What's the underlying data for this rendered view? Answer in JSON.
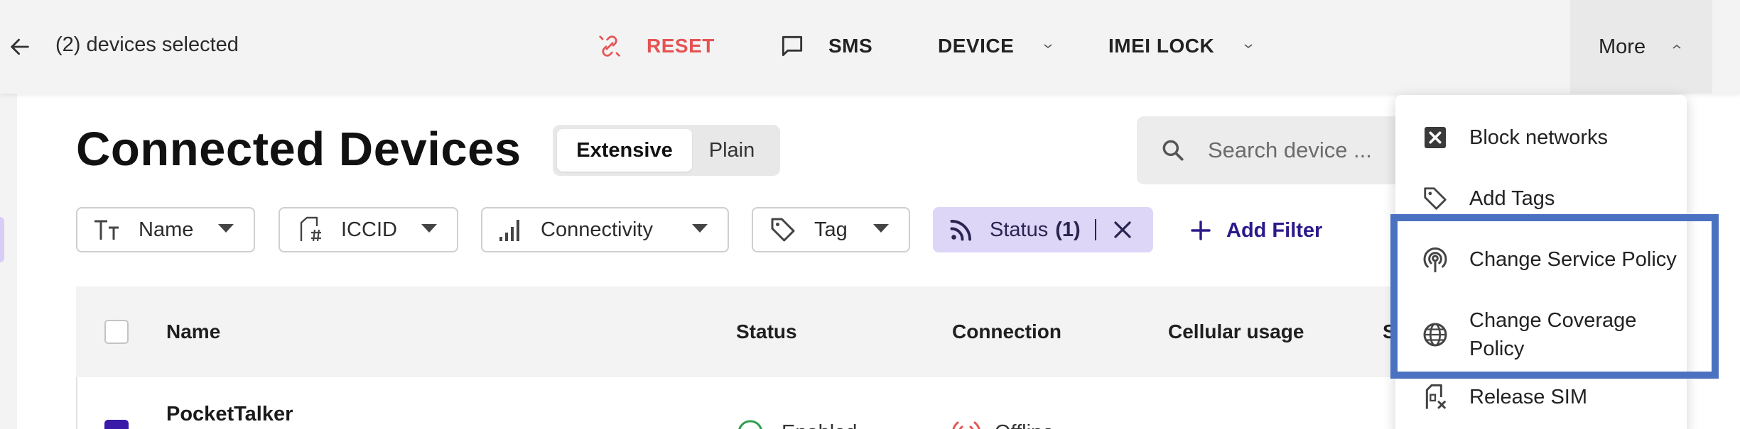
{
  "topbar": {
    "selected_text": "(2) devices selected",
    "actions": {
      "reset": "RESET",
      "sms": "SMS",
      "device": "DEVICE",
      "imei_lock": "IMEI LOCK"
    },
    "more": "More"
  },
  "header": {
    "title": "Connected Devices",
    "view_toggle": {
      "extensive": "Extensive",
      "plain": "Plain",
      "selected": "Extensive"
    },
    "search_placeholder": "Search device ..."
  },
  "filters": {
    "name": "Name",
    "iccid": "ICCID",
    "connectivity": "Connectivity",
    "tag": "Tag",
    "status_label": "Status",
    "status_count": "(1)",
    "add_filter": "Add Filter"
  },
  "table": {
    "columns": [
      "Name",
      "Status",
      "Connection",
      "Cellular usage",
      "S"
    ],
    "rows": [
      {
        "name": "PocketTalker",
        "status": "Enabled",
        "connection": "Offline"
      }
    ]
  },
  "menu": {
    "items": [
      {
        "label": "Block networks",
        "icon": "x-square-icon"
      },
      {
        "label": "Add Tags",
        "icon": "tag-icon"
      },
      {
        "label": "Change Service Policy",
        "icon": "broadcast-icon"
      },
      {
        "label": "Change Coverage Policy",
        "icon": "globe-icon"
      },
      {
        "label": "Release SIM",
        "icon": "sim-release-icon"
      }
    ]
  },
  "colors": {
    "accent": "#3a1aa8",
    "reset_red": "#e55353",
    "chip_bg": "#ddd6f7",
    "highlight_box": "#4a72c0"
  }
}
